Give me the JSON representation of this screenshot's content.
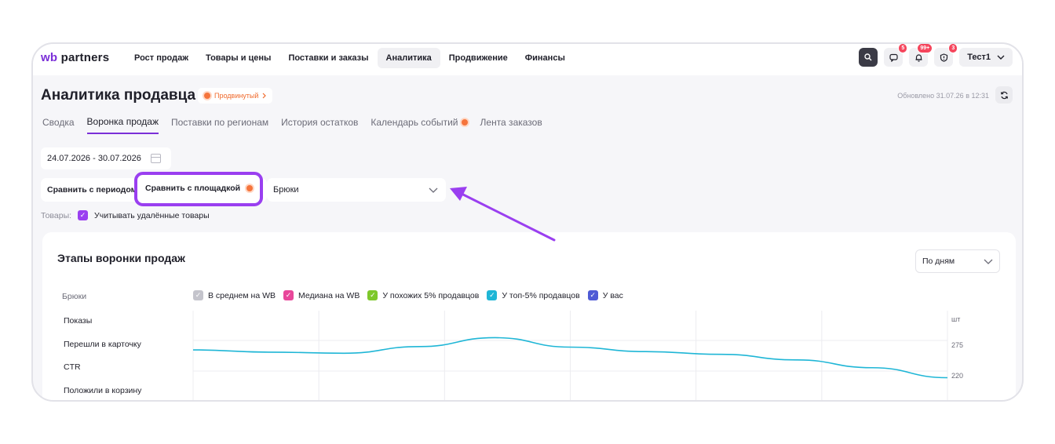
{
  "logo": {
    "wb": "wb",
    "partners": "partners"
  },
  "nav": [
    "Рост продаж",
    "Товары и цены",
    "Поставки и заказы",
    "Аналитика",
    "Продвижение",
    "Финансы"
  ],
  "nav_active": "Аналитика",
  "header_icons": [
    {
      "icon": "search-icon"
    },
    {
      "icon": "chat-icon",
      "badge": "5"
    },
    {
      "icon": "bell-icon",
      "badge": "99+"
    },
    {
      "icon": "support-icon",
      "badge": "3"
    }
  ],
  "user": {
    "name": "Тест1"
  },
  "page": {
    "title": "Аналитика продавца",
    "tier": "Продвинутый",
    "updated": "Обновлено 31.07.26 в 12:31"
  },
  "tabs": [
    "Сводка",
    "Воронка продаж",
    "Поставки по регионам",
    "История остатков",
    "Календарь событий",
    "Лента заказов"
  ],
  "tab_active": "Воронка продаж",
  "filters": {
    "date_range": "24.07.2026 - 30.07.2026",
    "compare_period": "Сравнить с периодом",
    "compare_platform": "Сравнить с площадкой",
    "category": "Брюки",
    "goods_label": "Товары:",
    "include_deleted": "Учитывать удалённые товары"
  },
  "card": {
    "title": "Этапы воронки продаж",
    "period": "По дням",
    "category_label": "Брюки",
    "legend": [
      {
        "label": "В среднем на WB",
        "color": "#c4c4cc"
      },
      {
        "label": "Медиана на WB",
        "color": "#e8479a"
      },
      {
        "label": "У похожих 5% продавцов",
        "color": "#7ec82b"
      },
      {
        "label": "У топ-5% продавцов",
        "color": "#1fb6d6"
      },
      {
        "label": "У вас",
        "color": "#4f5bd5"
      }
    ],
    "metrics": [
      "Показы",
      "Перешли в карточку",
      "CTR",
      "Положили в корзину"
    ]
  },
  "chart_data": {
    "type": "line",
    "unit": "шт",
    "ytick_labels": [
      "275",
      "220"
    ],
    "y": [
      258,
      254,
      252,
      264,
      280,
      263,
      255,
      250,
      240,
      226,
      208
    ],
    "series_color": "#1fb6d6"
  },
  "colors": {
    "accent": "#7b2fd8",
    "highlight": "#9a3ff0",
    "orange": "#f5743c"
  }
}
